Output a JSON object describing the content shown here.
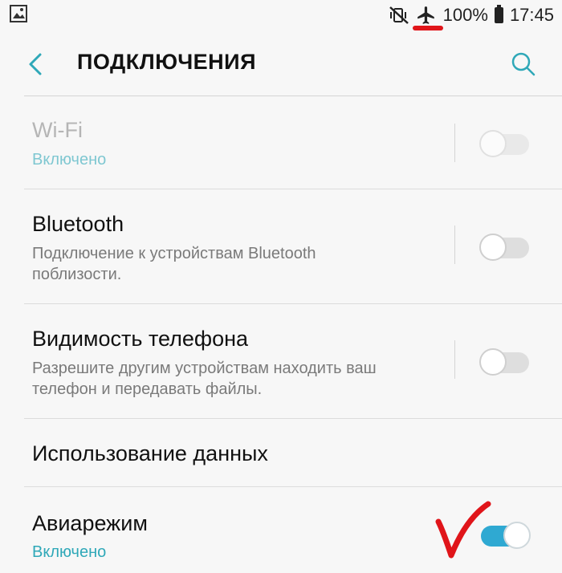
{
  "status_bar": {
    "battery_text": "100%",
    "time": "17:45",
    "icons": [
      "gallery-notification-icon",
      "mute-vibrate-icon",
      "airplane-icon",
      "battery-icon"
    ],
    "highlight_color": "#e0151a"
  },
  "header": {
    "title": "ПОДКЛЮЧЕНИЯ",
    "back_icon": "chevron-left-icon",
    "search_icon": "search-icon",
    "accent_color": "#2fa8b8"
  },
  "settings": [
    {
      "title": "Wi-Fi",
      "subtitle": "Включено",
      "toggle": "off",
      "disabled": true
    },
    {
      "title": "Bluetooth",
      "subtitle": "Подключение к устройствам Bluetooth поблизости.",
      "toggle": "off"
    },
    {
      "title": "Видимость телефона",
      "subtitle": "Разрешите другим устройствам находить ваш телефон и передавать файлы.",
      "toggle": "off"
    },
    {
      "title": "Использование данных"
    },
    {
      "title": "Авиарежим",
      "subtitle": "Включено",
      "toggle": "on"
    }
  ],
  "annotation": {
    "checkmark_color": "#e0151a"
  }
}
